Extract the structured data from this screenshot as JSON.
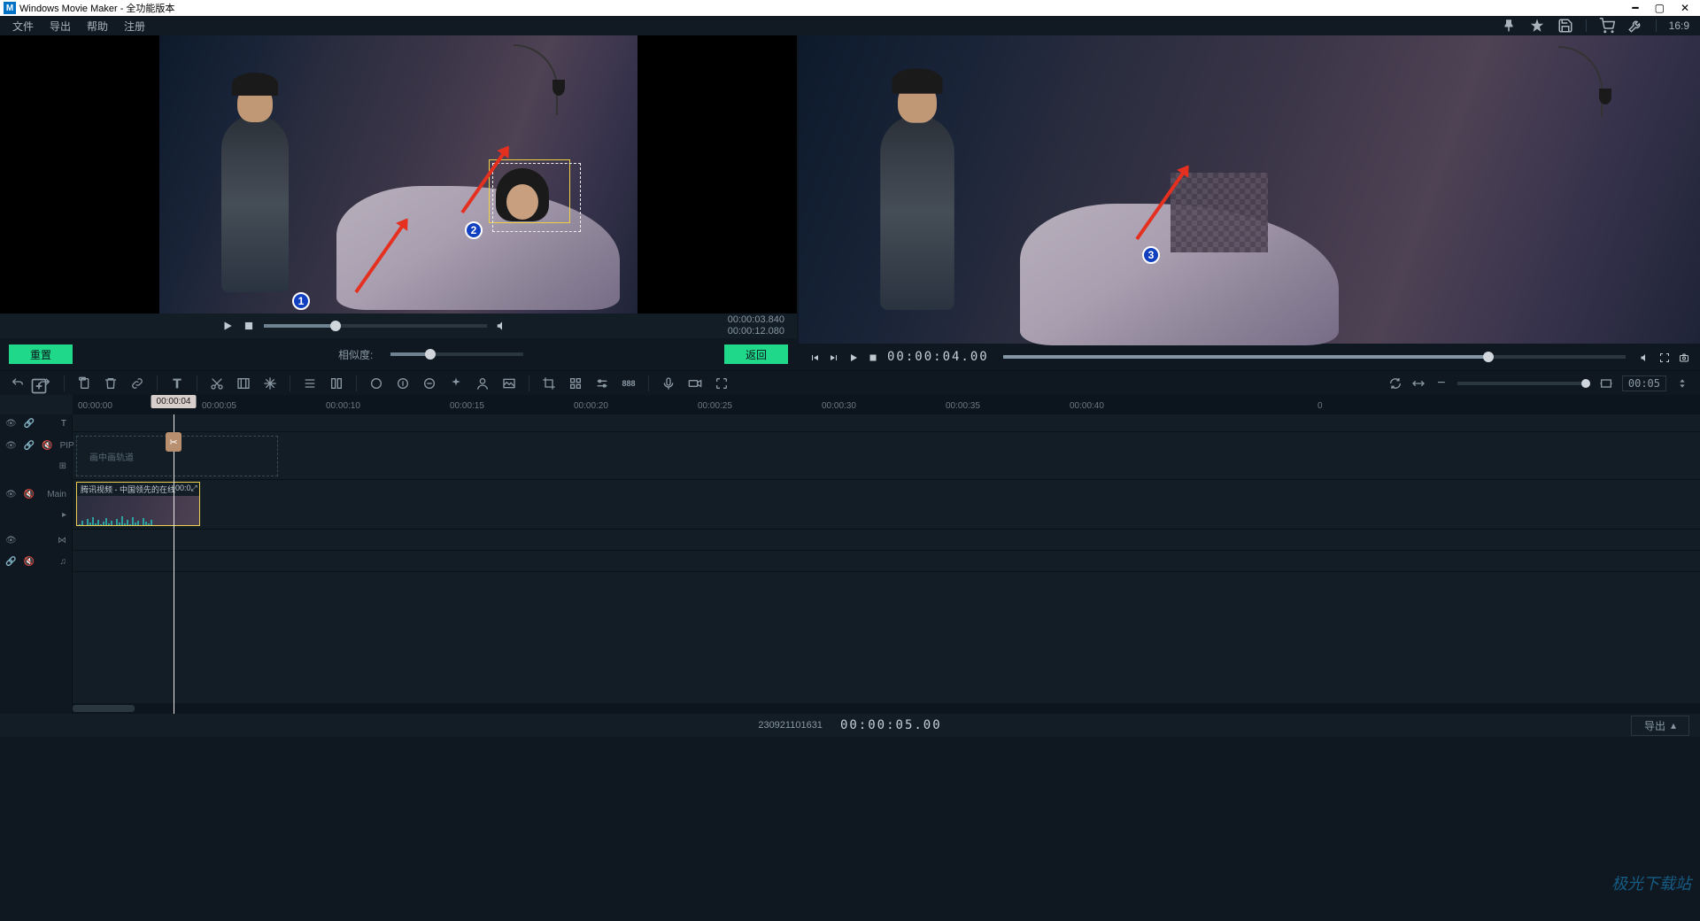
{
  "window": {
    "title": "Windows Movie Maker  - 全功能版本"
  },
  "menu": {
    "items": [
      "文件",
      "导出",
      "帮助",
      "注册"
    ],
    "aspect_label": "16:9"
  },
  "left_player": {
    "time_current": "00:00:03.840",
    "time_total": "00:00:12.080",
    "seek_percent": 32
  },
  "mid": {
    "reset_label": "重置",
    "similarity_label": "相似度:",
    "back_label": "返回"
  },
  "annotations": {
    "badge1": "1",
    "badge2": "2",
    "badge3": "3"
  },
  "right_player": {
    "timecode": "00:00:04.00",
    "seek_percent": 78
  },
  "toolbar": {
    "zoom_label": "00:05"
  },
  "timeline": {
    "playhead_label": "00:00:04",
    "ruler": [
      "00:00:00",
      "00:00:05",
      "00:00:10",
      "00:00:15",
      "00:00:20",
      "00:00:25",
      "00:00:30",
      "00:00:35",
      "00:00:40",
      "0"
    ],
    "pip_label": "PIP",
    "pip_placeholder": "画中画轨道",
    "main_label": "Main",
    "clip_title": "腾讯视频 - 中国领先的在线",
    "clip_time": "00:0"
  },
  "footer": {
    "build": "230921101631",
    "timecode": "00:00:05.00",
    "export_label": "导出"
  },
  "watermark": "极光下载站"
}
